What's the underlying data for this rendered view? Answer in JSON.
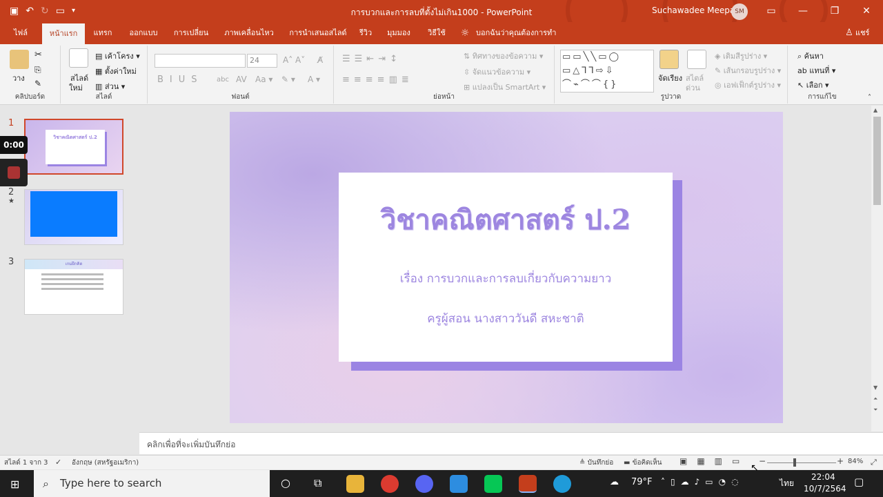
{
  "titlebar": {
    "title": "การบวกและการลบที่ตั้งไม่เกิน1000 - PowerPoint",
    "user": "Suchawadee Meepa",
    "initials": "SM",
    "accent": "#c43e1c"
  },
  "tabs": [
    "ไฟล์",
    "หน้าแรก",
    "แทรก",
    "ออกแบบ",
    "การเปลี่ยน",
    "ภาพเคลื่อนไหว",
    "การนำเสนอสไลด์",
    "รีวิว",
    "มุมมอง",
    "วิธีใช้"
  ],
  "tell_me": "บอกฉันว่าคุณต้องการทำอะไร",
  "share": "แชร์",
  "ribbon": {
    "clipboard": {
      "paste": "วาง",
      "label": "คลิปบอร์ด"
    },
    "slides": {
      "new_slide": "สไลด์",
      "new_slide2": "ใหม่",
      "layout": "เค้าโครง",
      "reset": "ตั้งค่าใหม่",
      "section": "ส่วน",
      "label": "สไลด์"
    },
    "font": {
      "size": "24",
      "label": "ฟอนต์"
    },
    "paragraph": {
      "text_direction": "ทิศทางของข้อความ",
      "align_text": "จัดแนวข้อความ",
      "smartart": "แปลงเป็น SmartArt",
      "label": "ย่อหน้า"
    },
    "drawing": {
      "arrange": "จัดเรียง",
      "quick_styles": "สไตล์",
      "quick_styles2": "ด่วน",
      "fill": "เติมสีรูปร่าง",
      "outline": "เส้นกรอบรูปร่าง",
      "effects": "เอฟเฟ็กต์รูปร่าง",
      "label": "รูปวาด"
    },
    "editing": {
      "find": "ค้นหา",
      "replace": "แทนที่",
      "select": "เลือก",
      "label": "การแก้ไข"
    }
  },
  "thumbnails": [
    {
      "num": "1",
      "title": "วิชาคณิตศาสตร์ ป.2"
    },
    {
      "num": "2",
      "title": ""
    },
    {
      "num": "3",
      "title": "เกมฝึกคิด"
    }
  ],
  "slide": {
    "title": "วิชาคณิตศาสตร์ ป.2",
    "subtitle": "เรื่อง การบวกและการลบเกี่ยวกับความยาว",
    "teacher": "ครูผู้สอน นางสาววันดี สหะชาติ"
  },
  "notes_placeholder": "คลิกเพื่อที่จะเพิ่มบันทึกย่อ",
  "status": {
    "slide_info": "สไลด์ 1 จาก 3",
    "language": "อังกฤษ (สหรัฐอเมริกา)",
    "notes": "บันทึกย่อ",
    "comments": "ข้อคิดเห็น",
    "zoom": "84%"
  },
  "recorder": {
    "time": "0:00"
  },
  "taskbar": {
    "search_placeholder": "Type here to search",
    "weather": "79°F",
    "lang": "ไทย",
    "time": "22:04",
    "date": "10/7/2564"
  }
}
